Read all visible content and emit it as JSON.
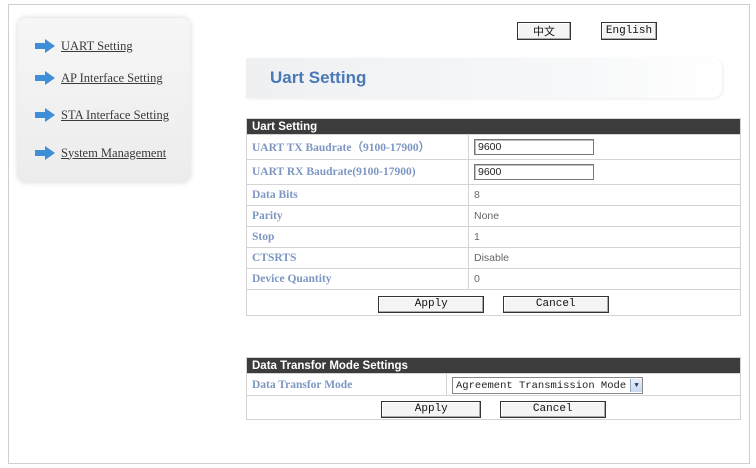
{
  "sidebar": {
    "items": [
      {
        "label": "UART Setting"
      },
      {
        "label": "AP Interface Setting"
      },
      {
        "label": "STA Interface Setting"
      },
      {
        "label": "System Management"
      }
    ]
  },
  "language": {
    "chinese_label": "中文",
    "english_label": "English"
  },
  "page_title": "Uart Setting",
  "uart": {
    "header": "Uart Setting",
    "tx_label": "UART TX Baudrate（9100-17900）",
    "tx_value": "9600",
    "rx_label": "UART RX Baudrate(9100-17900)",
    "rx_value": "9600",
    "rows": [
      {
        "label": "Data Bits",
        "value": "8"
      },
      {
        "label": "Parity",
        "value": "None"
      },
      {
        "label": "Stop",
        "value": "1"
      },
      {
        "label": "CTSRTS",
        "value": "Disable"
      },
      {
        "label": "Device Quantity",
        "value": "0"
      }
    ],
    "apply_label": "Apply",
    "cancel_label": "Cancel"
  },
  "transfer": {
    "header": "Data Transfor Mode Settings",
    "mode_label": "Data Transfor Mode",
    "mode_value": "Agreement Transmission Mode",
    "apply_label": "Apply",
    "cancel_label": "Cancel"
  },
  "icons": {
    "nav_arrow": "arrow-right-icon",
    "select_chevron": "chevron-down-icon"
  },
  "colors": {
    "header_bg": "#3c3c3c",
    "label_text": "#7d97c2",
    "title_text": "#4a78b8",
    "nav_arrow": "#3f8fd8"
  }
}
